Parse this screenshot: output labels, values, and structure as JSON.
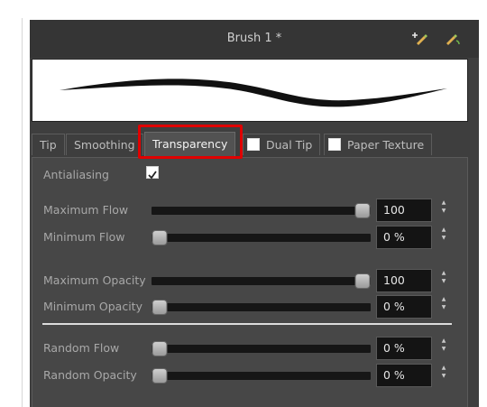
{
  "panel": {
    "title": "Brush 1 *",
    "icons": [
      "add-brush-icon",
      "rename-brush-icon"
    ]
  },
  "tabs": {
    "tip": "Tip",
    "smoothing": "Smoothing",
    "transparency": "Transparency",
    "dual_tip": "Dual Tip",
    "paper_texture": "Paper Texture",
    "dual_tip_checked": false,
    "paper_texture_checked": false
  },
  "transparency": {
    "antialiasing_label": "Antialiasing",
    "antialiasing_checked": true,
    "rows": {
      "max_flow": {
        "label": "Maximum Flow",
        "value": "100",
        "level": 1.0
      },
      "min_flow": {
        "label": "Minimum Flow",
        "value": "0 %",
        "level": 0.0
      },
      "max_opacity": {
        "label": "Maximum Opacity",
        "value": "100",
        "level": 1.0
      },
      "min_opacity": {
        "label": "Minimum Opacity",
        "value": "0 %",
        "level": 0.0
      },
      "random_flow": {
        "label": "Random Flow",
        "value": "0 %",
        "level": 0.0
      },
      "random_opacity": {
        "label": "Random Opacity",
        "value": "0 %",
        "level": 0.0
      }
    }
  },
  "colors": {
    "highlight": "#e00000",
    "panel_bg": "#3e3e3e",
    "field_bg": "#141414"
  }
}
